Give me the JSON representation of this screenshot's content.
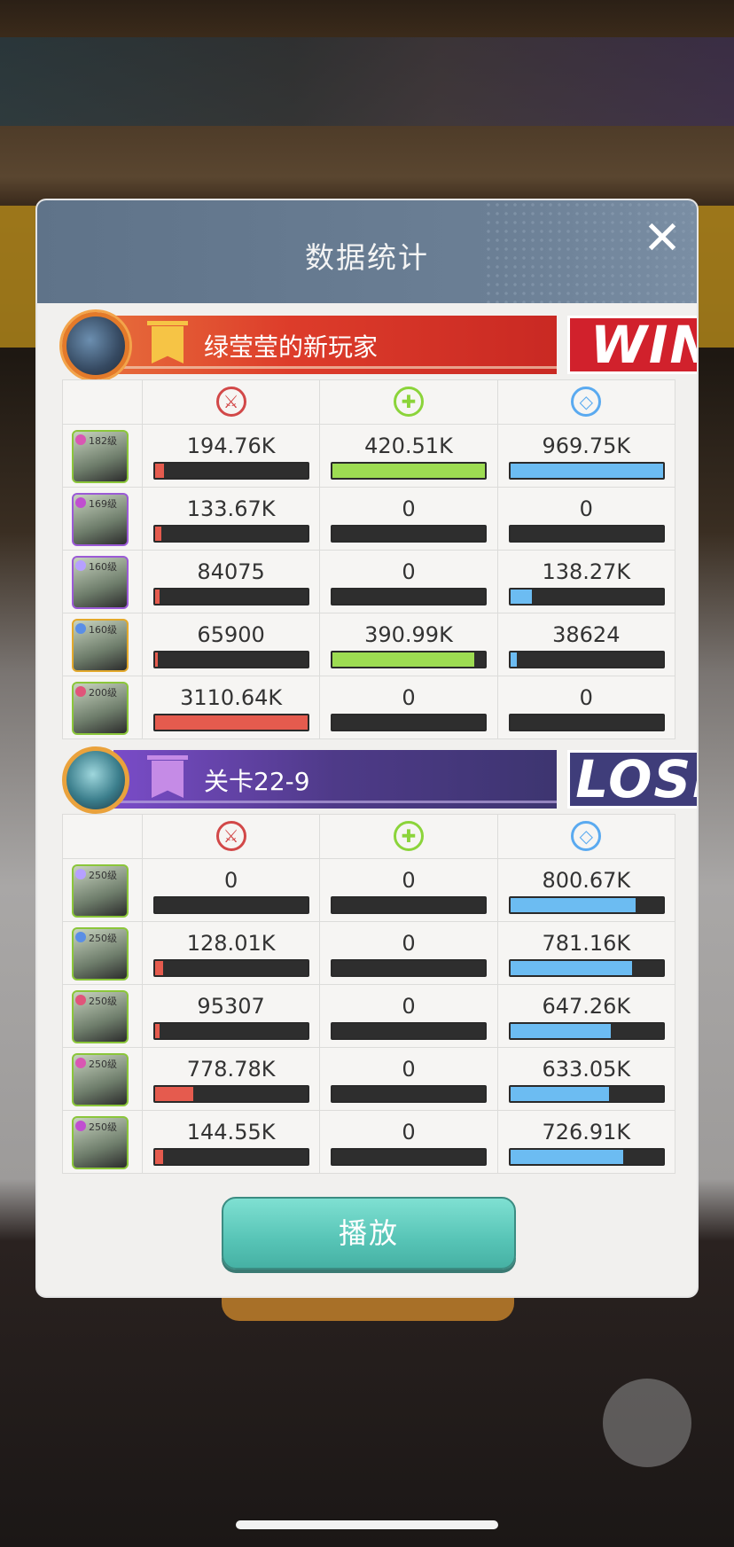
{
  "dialog": {
    "title": "数据统计",
    "close_icon": "close-icon",
    "play_label": "播放"
  },
  "colors": {
    "attack": "#e55b4e",
    "heal": "#9ddc52",
    "defense": "#6cbcf2",
    "win": "#d1212c",
    "lose": "#3f3d7a",
    "play_button": "#57c4b6"
  },
  "stat_icons": [
    "attack-icon",
    "heal-icon",
    "shield-icon"
  ],
  "teams": [
    {
      "name": "绿莹莹的新玩家",
      "result": "WIN",
      "heroes": [
        {
          "level": "182级",
          "attack": "194.76K",
          "heal": "420.51K",
          "defense": "969.75K",
          "attack_fill": 0.06,
          "heal_fill": 1.0,
          "defense_fill": 1.0
        },
        {
          "level": "169级",
          "attack": "133.67K",
          "heal": "0",
          "defense": "0",
          "attack_fill": 0.04,
          "heal_fill": 0,
          "defense_fill": 0
        },
        {
          "level": "160级",
          "attack": "84075",
          "heal": "0",
          "defense": "138.27K",
          "attack_fill": 0.03,
          "heal_fill": 0,
          "defense_fill": 0.14
        },
        {
          "level": "160级",
          "attack": "65900",
          "heal": "390.99K",
          "defense": "38624",
          "attack_fill": 0.02,
          "heal_fill": 0.93,
          "defense_fill": 0.04
        },
        {
          "level": "200级",
          "attack": "3110.64K",
          "heal": "0",
          "defense": "0",
          "attack_fill": 1.0,
          "heal_fill": 0,
          "defense_fill": 0
        }
      ]
    },
    {
      "name": "关卡22-9",
      "result": "LOSE",
      "heroes": [
        {
          "level": "250级",
          "attack": "0",
          "heal": "0",
          "defense": "800.67K",
          "attack_fill": 0,
          "heal_fill": 0,
          "defense_fill": 0.82
        },
        {
          "level": "250级",
          "attack": "128.01K",
          "heal": "0",
          "defense": "781.16K",
          "attack_fill": 0.05,
          "heal_fill": 0,
          "defense_fill": 0.8
        },
        {
          "level": "250级",
          "attack": "95307",
          "heal": "0",
          "defense": "647.26K",
          "attack_fill": 0.03,
          "heal_fill": 0,
          "defense_fill": 0.66
        },
        {
          "level": "250级",
          "attack": "778.78K",
          "heal": "0",
          "defense": "633.05K",
          "attack_fill": 0.25,
          "heal_fill": 0,
          "defense_fill": 0.65
        },
        {
          "level": "250级",
          "attack": "144.55K",
          "heal": "0",
          "defense": "726.91K",
          "attack_fill": 0.05,
          "heal_fill": 0,
          "defense_fill": 0.74
        }
      ]
    }
  ]
}
